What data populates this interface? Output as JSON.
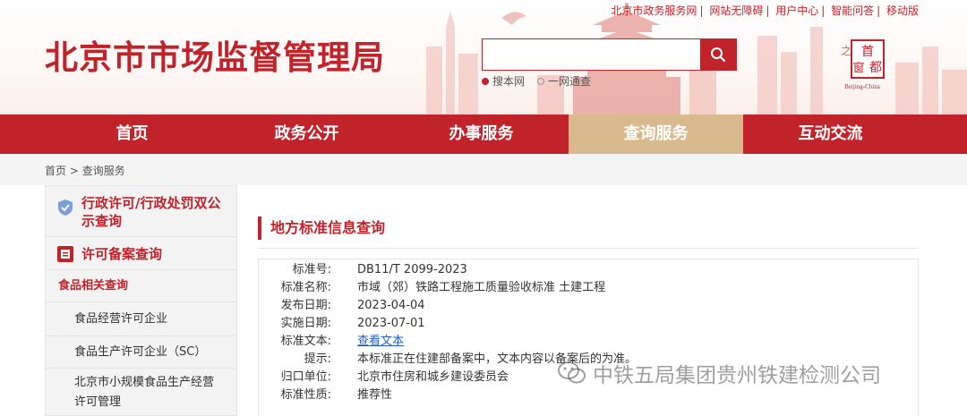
{
  "header": {
    "site_title": "北京市市场监督管理局",
    "top_links": [
      "北京市政务服务网",
      "网站无障碍",
      "用户中心",
      "智能问答",
      "移动版"
    ],
    "search": {
      "placeholder": "",
      "options": [
        "搜本网",
        "一网通查"
      ],
      "selected": "搜本网"
    },
    "seal": {
      "chars": [
        "首",
        "都",
        "之",
        "窗"
      ],
      "caption": "Beijing-China"
    }
  },
  "nav": {
    "items": [
      "首页",
      "政务公开",
      "办事服务",
      "查询服务",
      "互动交流"
    ],
    "active": "查询服务"
  },
  "breadcrumb": {
    "home": "首页",
    "separator": ">",
    "current": "查询服务"
  },
  "sidebar": {
    "groups": [
      {
        "label": "行政许可/行政处罚双公示查询",
        "icon": "shield-check-icon"
      },
      {
        "label": "许可备案查询",
        "icon": "document-icon"
      }
    ],
    "sub_heading": "食品相关查询",
    "items": [
      "食品经营许可企业",
      "食品生产许可企业（SC）",
      "北京市小规模食品生产经营许可管理"
    ]
  },
  "main": {
    "heading": "地方标准信息查询",
    "fields": [
      {
        "key": "标准号:",
        "value": "DB11/T 2099-2023"
      },
      {
        "key": "标准名称:",
        "value": "市域（郊）铁路工程施工质量验收标准 土建工程"
      },
      {
        "key": "发布日期:",
        "value": "2023-04-04"
      },
      {
        "key": "实施日期:",
        "value": "2023-07-01"
      },
      {
        "key": "标准文本:",
        "value": "查看文本",
        "link": true
      },
      {
        "key": "提示:",
        "value": "本标准正在住建部备案中，文本内容以备案后的为准。"
      },
      {
        "key": "归口单位:",
        "value": "北京市住房和城乡建设委员会"
      },
      {
        "key": "标准性质:",
        "value": "推荐性"
      }
    ]
  },
  "watermark": {
    "text": "中铁五局集团贵州铁建检测公司",
    "icon": "wechat-icon"
  },
  "colors": {
    "primary_red": "#c1232b",
    "nav_active": "#d9b98e",
    "link_blue": "#2561c4",
    "sidebar_bg": "#f3f3f3"
  }
}
